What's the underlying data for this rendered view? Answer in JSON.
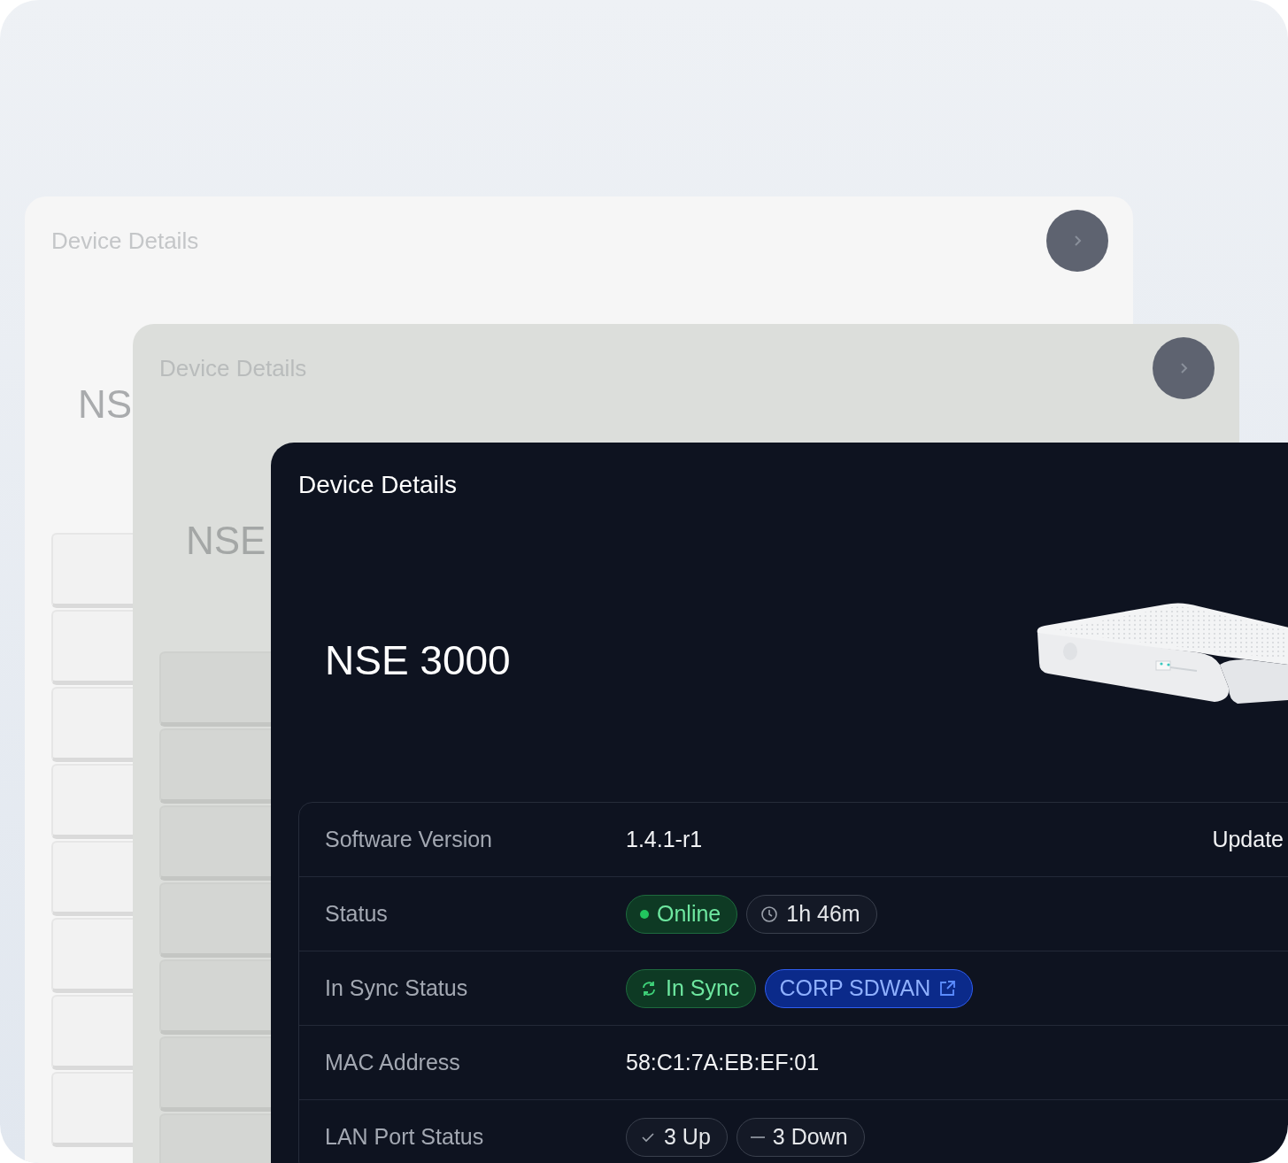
{
  "back_cards": [
    {
      "title": "Device Details",
      "device_name": "NS"
    },
    {
      "title": "Device Details",
      "device_name": "NSE"
    }
  ],
  "card": {
    "title": "Device Details",
    "device_name": "NSE 3000",
    "rows": [
      {
        "label": "Software Version",
        "kind": "text",
        "value": "1.4.1-r1",
        "action": "Update"
      },
      {
        "label": "Status",
        "kind": "pills",
        "pills": [
          {
            "kind": "online",
            "text": "Online"
          },
          {
            "kind": "duration",
            "text": "1h 46m"
          }
        ]
      },
      {
        "label": "In Sync Status",
        "kind": "pills",
        "pills": [
          {
            "kind": "sync",
            "text": "In Sync"
          },
          {
            "kind": "link",
            "text": "CORP SDWAN"
          }
        ]
      },
      {
        "label": "MAC Address",
        "kind": "text",
        "value": "58:C1:7A:EB:EF:01"
      },
      {
        "label": "LAN Port Status",
        "kind": "pills",
        "pills": [
          {
            "kind": "up",
            "text": "3 Up"
          },
          {
            "kind": "down",
            "text": "3 Down"
          }
        ]
      }
    ]
  }
}
